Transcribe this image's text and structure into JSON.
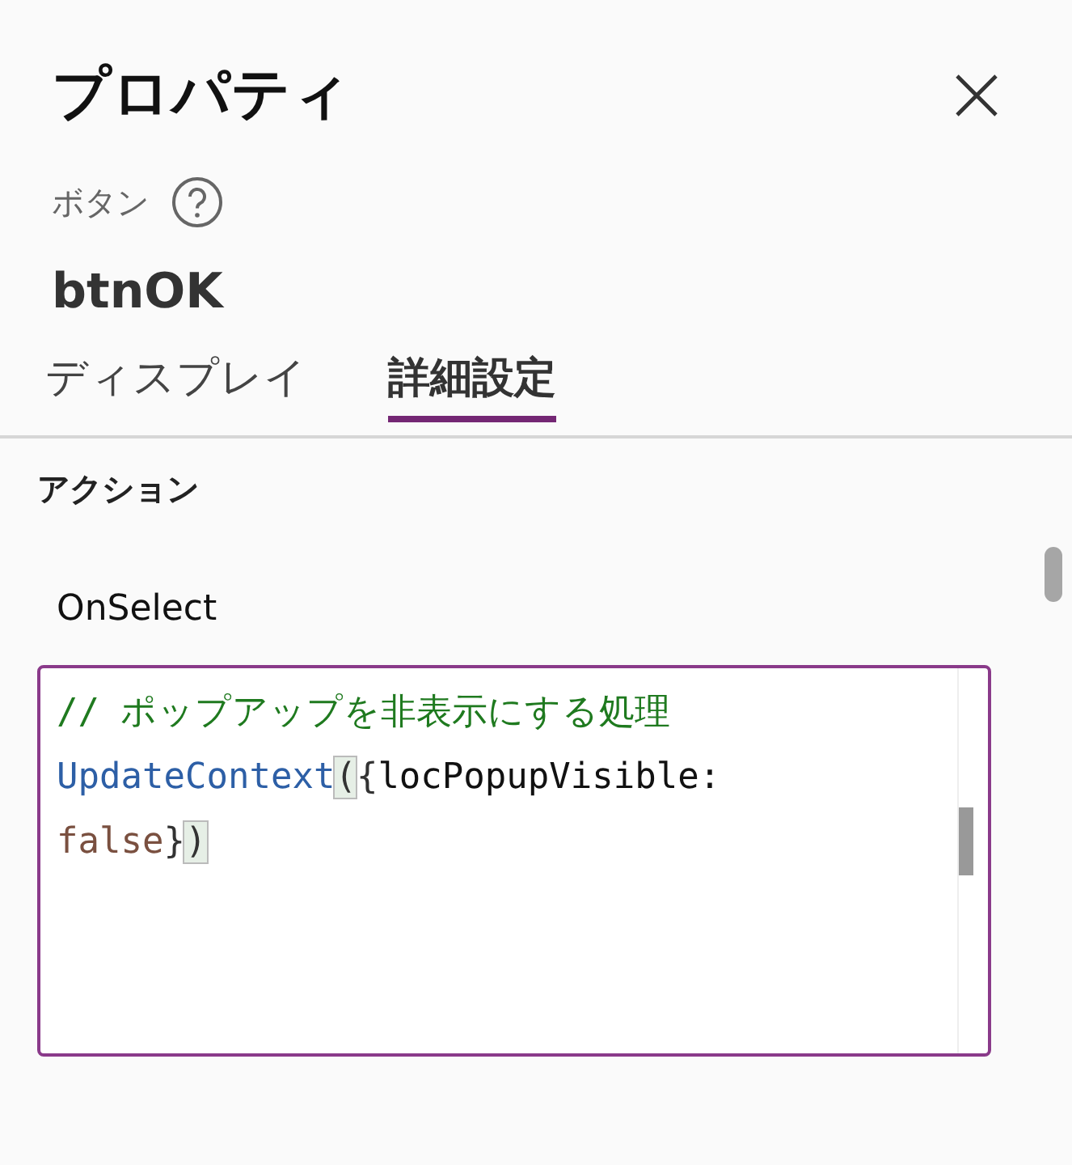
{
  "panel": {
    "title": "プロパティ",
    "control_type": "ボタン",
    "control_name": "btnOK"
  },
  "tabs": [
    {
      "label": "ディスプレイ",
      "selected": false
    },
    {
      "label": "詳細設定",
      "selected": true
    }
  ],
  "section": {
    "heading": "アクション",
    "property": "OnSelect",
    "code_lines": [
      [
        {
          "kind": "comment",
          "text": "// ポップアップを非表示にする処理"
        }
      ],
      [
        {
          "kind": "function",
          "text": "UpdateContext"
        },
        {
          "kind": "bracket",
          "text": "("
        },
        {
          "kind": "punct",
          "text": "{"
        },
        {
          "kind": "identifier",
          "text": "locPopupVisible:"
        }
      ],
      [
        {
          "kind": "keyword",
          "text": "false"
        },
        {
          "kind": "punct",
          "text": "}"
        },
        {
          "kind": "bracket",
          "text": ")"
        }
      ]
    ]
  }
}
